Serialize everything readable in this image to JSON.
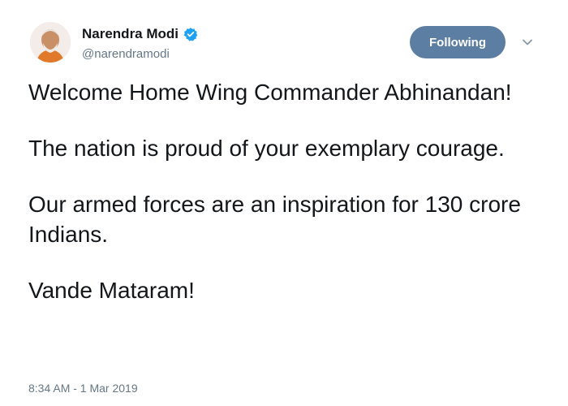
{
  "author": {
    "name": "Narendra Modi",
    "handle": "@narendramodi",
    "verified_icon": "verified-badge-icon"
  },
  "actions": {
    "follow_label": "Following",
    "menu_icon": "chevron-down-icon"
  },
  "tweet": {
    "paragraphs": [
      "Welcome Home Wing Commander Abhinandan!",
      "The nation is proud of your exemplary courage.",
      "Our armed forces are an inspiration for 130 crore Indians.",
      "Vande Mataram!"
    ],
    "timestamp": "8:34 AM - 1 Mar 2019"
  },
  "colors": {
    "button_bg": "#5c7ea3",
    "verified": "#1da1f2",
    "muted_text": "#657786"
  }
}
